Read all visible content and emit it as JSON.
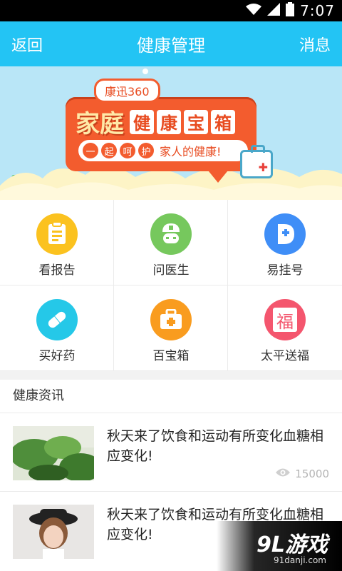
{
  "status_bar": {
    "time": "7:07"
  },
  "app_bar": {
    "back_label": "返回",
    "title": "健康管理",
    "messages_label": "消息"
  },
  "banner": {
    "brand": "康迅360",
    "headline_part1": "家庭",
    "headline_boxes": [
      "健",
      "康",
      "宝",
      "箱"
    ],
    "tagline_chars": [
      "一",
      "起",
      "呵",
      "护"
    ],
    "tagline_rest": "家人的健康!",
    "sky_color": "#b9e6f7",
    "accent_color": "#f35c2e"
  },
  "shortcuts": [
    {
      "label": "看报告",
      "icon": "report-icon",
      "color": "#fbc21f"
    },
    {
      "label": "问医生",
      "icon": "doctor-icon",
      "color": "#76c85d"
    },
    {
      "label": "易挂号",
      "icon": "registration-icon",
      "color": "#3f8ef7"
    },
    {
      "label": "买好药",
      "icon": "pill-icon",
      "color": "#25c8e8"
    },
    {
      "label": "百宝箱",
      "icon": "toolbox-icon",
      "color": "#f99c1f"
    },
    {
      "label": "太平送福",
      "icon": "fu-icon",
      "color": "#f4566e",
      "glyph": "福"
    }
  ],
  "news": {
    "section_title": "健康资讯",
    "items": [
      {
        "title": "秋天来了饮食和运动有所变化血糖相应变化!",
        "views": "15000"
      },
      {
        "title": "秋天来了饮食和运动有所变化血糖相应变化!"
      }
    ]
  },
  "watermark": {
    "logo": "9L游戏",
    "url": "91danji.com"
  }
}
